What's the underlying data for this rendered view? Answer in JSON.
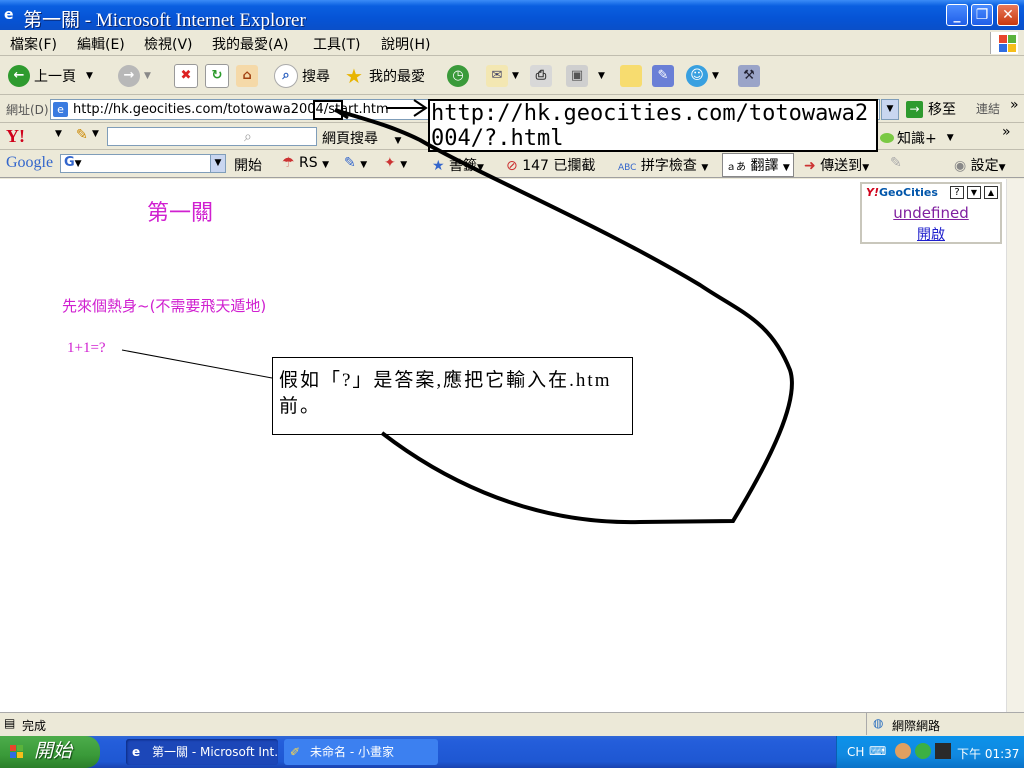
{
  "window": {
    "title": "第一關 - Microsoft Internet Explorer",
    "min": "_",
    "max": "❐",
    "close": "✕"
  },
  "menu": [
    "檔案(F)",
    "編輯(E)",
    "檢視(V)",
    "我的最愛(A)",
    "工具(T)",
    "說明(H)"
  ],
  "toolbar": {
    "back": "上一頁",
    "search": "搜尋",
    "favorites": "我的最愛"
  },
  "address": {
    "label": "網址(D)",
    "url": "http://hk.geocities.com/totowawa2004/start.htm",
    "go": "移至",
    "links": "連結"
  },
  "yahoo_bar": {
    "logo": "Y!",
    "web_search": "網頁搜尋",
    "knowledge": "知識+"
  },
  "google_bar": {
    "logo": "Google",
    "g": "G",
    "start": "開始",
    "rs": "RS",
    "bookmarks": "書籤",
    "blocked": "147 已攔截",
    "spell": "拼字檢查",
    "translate": "翻譯",
    "send": "傳送到",
    "settings": "設定"
  },
  "page": {
    "heading": "第一關",
    "warmup": "先來個熱身~(不需要飛天遁地)",
    "question": "1+1=?",
    "hint": "假如「?」是答案,應把它輸入在.htm 前。",
    "url_hint": "http://hk.geocities.com/totowawa2004/?.html"
  },
  "geocities": {
    "logo_y": "Y!",
    "logo": "GeoCities",
    "line1": "undefined",
    "line2": "開啟"
  },
  "status": {
    "left": "完成",
    "right": "網際網路"
  },
  "taskbar": {
    "start": "開始",
    "task1": "第一關 - Microsoft Int...",
    "task2": "未命名 - 小畫家",
    "lang": "CH",
    "time": "下午 01:37"
  }
}
